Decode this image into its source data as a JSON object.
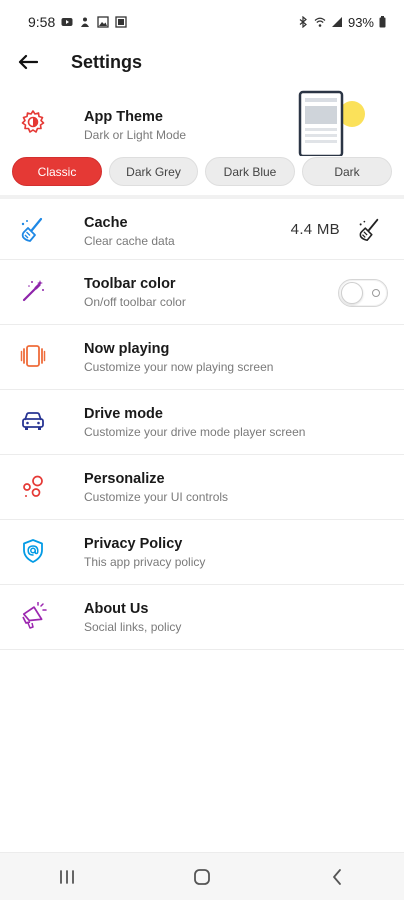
{
  "status_bar": {
    "time": "9:58",
    "battery": "93%"
  },
  "app_bar": {
    "title": "Settings"
  },
  "app_theme": {
    "title": "App Theme",
    "subtitle": "Dark or Light Mode",
    "chips": [
      {
        "label": "Classic",
        "active": true
      },
      {
        "label": "Dark Grey",
        "active": false
      },
      {
        "label": "Dark Blue",
        "active": false
      },
      {
        "label": "Dark",
        "active": false
      }
    ]
  },
  "items": [
    {
      "id": "cache",
      "title": "Cache",
      "subtitle": "Clear cache data",
      "value": "4.4 MB"
    },
    {
      "id": "toolbar-color",
      "title": "Toolbar color",
      "subtitle": "On/off toolbar color",
      "toggle_on": false
    },
    {
      "id": "now-playing",
      "title": "Now playing",
      "subtitle": "Customize your now playing screen"
    },
    {
      "id": "drive-mode",
      "title": "Drive mode",
      "subtitle": "Customize your drive mode player screen"
    },
    {
      "id": "personalize",
      "title": "Personalize",
      "subtitle": "Customize your UI controls"
    },
    {
      "id": "privacy-policy",
      "title": "Privacy Policy",
      "subtitle": "This app privacy policy"
    },
    {
      "id": "about-us",
      "title": "About Us",
      "subtitle": "Social links, policy"
    }
  ],
  "colors": {
    "accent": "#e53935",
    "cache_icon": "#1e88e5",
    "toolbar_icon": "#8e24aa",
    "now_playing_icon": "#ef6c3a",
    "drive_icon": "#283593",
    "personalize_icon": "#e53935",
    "privacy_icon": "#039be5",
    "about_icon": "#9c27b0"
  },
  "icons": {
    "back": "arrow-left-icon",
    "theme": "theme-gear-icon",
    "cache": "broom-icon",
    "toolbar": "magic-wand-icon",
    "now_playing": "now-playing-icon",
    "drive": "car-icon",
    "personalize": "bubbles-icon",
    "privacy": "shield-at-icon",
    "about": "megaphone-icon"
  }
}
